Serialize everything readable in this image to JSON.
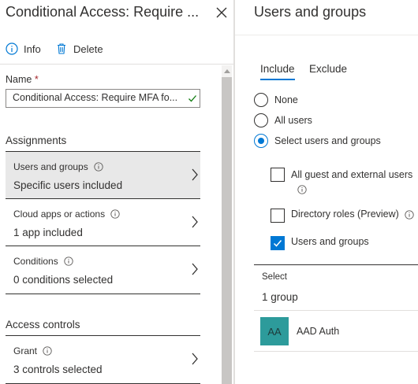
{
  "left_blade": {
    "title": "Conditional Access: Require ...",
    "toolbar": {
      "info_label": "Info",
      "delete_label": "Delete"
    },
    "name": {
      "label": "Name",
      "required_marker": "*",
      "value": "Conditional Access: Require MFA fo..."
    },
    "assignments": {
      "heading": "Assignments",
      "items": [
        {
          "title": "Users and groups",
          "value": "Specific users included",
          "selected": true
        },
        {
          "title": "Cloud apps or actions",
          "value": "1 app included",
          "selected": false
        },
        {
          "title": "Conditions",
          "value": "0 conditions selected",
          "selected": false
        }
      ]
    },
    "access_controls": {
      "heading": "Access controls",
      "items": [
        {
          "title": "Grant",
          "value": "3 controls selected"
        }
      ]
    }
  },
  "right_blade": {
    "title": "Users and groups",
    "tabs": [
      {
        "label": "Include",
        "active": true
      },
      {
        "label": "Exclude",
        "active": false
      }
    ],
    "radios": [
      {
        "label": "None",
        "checked": false
      },
      {
        "label": "All users",
        "checked": false
      },
      {
        "label": "Select users and groups",
        "checked": true
      }
    ],
    "checkboxes": [
      {
        "label": "All guest and external users",
        "checked": false
      },
      {
        "label": "Directory roles (Preview)",
        "checked": false
      },
      {
        "label": "Users and groups",
        "checked": true
      }
    ],
    "select": {
      "label": "Select",
      "value": "1 group"
    },
    "selected_group": {
      "initials": "AA",
      "name": "AAD Auth"
    }
  },
  "colors": {
    "accent": "#0078d4",
    "avatar_bg": "#2d9b9b",
    "selected_row": "#e8e8e8",
    "valid_check": "#107c10"
  }
}
